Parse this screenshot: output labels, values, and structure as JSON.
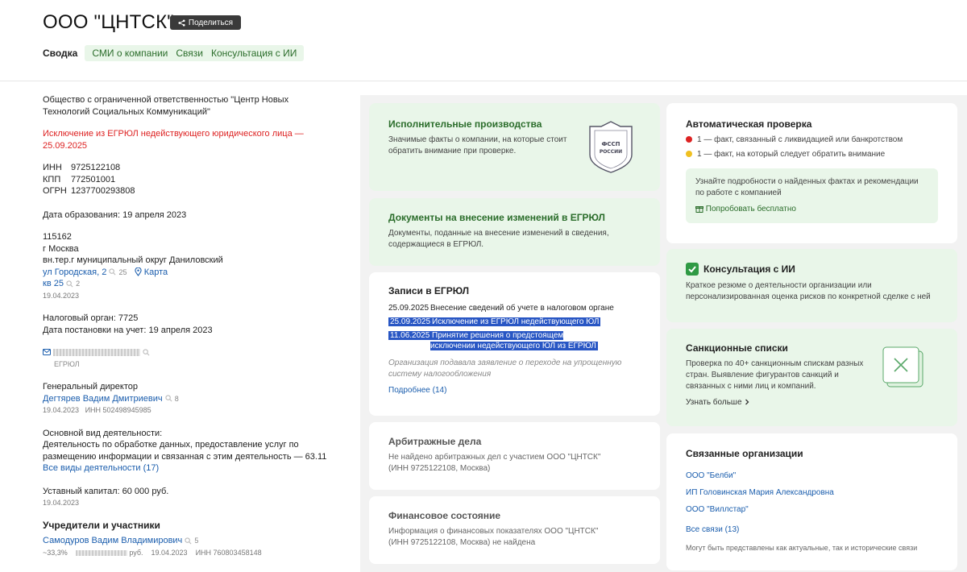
{
  "header": {
    "title": "ООО \"ЦНТСК\"",
    "share_label": "Поделиться",
    "tab_active": "Сводка",
    "tabs": [
      "СМИ о компании",
      "Связи",
      "Консультация с ИИ"
    ]
  },
  "left": {
    "full_name": "Общество с ограниченной ответственностью \"Центр Новых Технологий Социальных Коммуникаций\"",
    "exclusion": "Исключение из ЕГРЮЛ недействующего юридического лица — 25.09.2025",
    "inn_label": "ИНН",
    "inn": "9725122108",
    "kpp_label": "КПП",
    "kpp": "772501001",
    "ogrn_label": "ОГРН",
    "ogrn": "1237700293808",
    "founded": "Дата образования: 19 апреля 2023",
    "addr_zip": "115162",
    "addr_city": "г Москва",
    "addr_district": "вн.тер.г муниципальный округ Даниловский",
    "addr_street": "ул Городская, 2",
    "addr_street_count": "25",
    "map_label": "Карта",
    "addr_flat": "кв 25",
    "addr_flat_count": "2",
    "addr_date": "19.04.2023",
    "tax_org": "Налоговый орган: 7725",
    "tax_date": "Дата постановки на учет: 19 апреля 2023",
    "email_source": "ЕГРЮЛ",
    "director_role": "Генеральный директор",
    "director_name": "Дегтярев Вадим Дмитриевич",
    "director_count": "8",
    "director_date": "19.04.2023",
    "director_inn": "ИНН 502498945985",
    "activity_label": "Основной вид деятельности:",
    "activity_text": "Деятельность по обработке данных, предоставление услуг по размещению информации и связанная с этим деятельность — 63.11",
    "activity_all": "Все виды деятельности (17)",
    "capital": "Уставный капитал: 60 000 руб.",
    "capital_date": "19.04.2023",
    "founders_title": "Учредители и участники",
    "founder_name": "Самодуров Вадим Владимирович",
    "founder_count": "5",
    "founder_share": "~33,3%",
    "founder_rub": "руб.",
    "founder_date": "19.04.2023",
    "founder_inn": "ИНН 760803458148"
  },
  "cards": {
    "fssp_title": "Исполнительные производства",
    "fssp_text": "Значимые факты о компании, на которые стоит обратить внимание при проверке.",
    "fssp_badge_1": "ФССП",
    "fssp_badge_2": "РОССИИ",
    "docs_title": "Документы на внесение изменений в ЕГРЮЛ",
    "docs_text": "Документы, поданные на внесение изменений в сведения, содержащиеся в ЕГРЮЛ.",
    "egrul_title": "Записи в ЕГРЮЛ",
    "egrul_rows": [
      {
        "date": "25.09.2025",
        "text": "Внесение сведений об учете в налоговом органе"
      },
      {
        "date": "25.09.2025",
        "text": "Исключение из ЕГРЮЛ недействующего ЮЛ"
      },
      {
        "date": "11.06.2025",
        "text": "Принятие решения о предстоящем исключении недействующего ЮЛ из ЕГРЮЛ"
      }
    ],
    "egrul_note": "Организация подавала заявление о переходе на упрощенную систему налогообложения",
    "egrul_more": "Подробнее (14)",
    "arb_title": "Арбитражные дела",
    "arb_text": "Не найдено арбитражных дел с участием ООО \"ЦНТСК\" (ИНН 9725122108, Москва)",
    "fin_title": "Финансовое состояние",
    "fin_text": "Информация о финансовых показателях ООО \"ЦНТСК\" (ИНН 9725122108, Москва) не найдена",
    "auto_title": "Автоматическая проверка",
    "auto_red": "1 — факт, связанный с ликвидацией или банкротством",
    "auto_yellow": "1 — факт, на который следует обратить внимание",
    "auto_promo": "Узнайте подробности о найденных фактах и рекомендации по работе с компанией",
    "auto_try": "Попробовать бесплатно",
    "ai_title": "Консультация с ИИ",
    "ai_text": "Краткое резюме о деятельности организации или персонализированная оценка рисков по конкретной сделке с ней",
    "sanc_title": "Санкционные списки",
    "sanc_text": "Проверка по 40+ санкционным спискам разных стран. Выявление фигурантов санкций и связанных с ними лиц и компаний.",
    "sanc_more": "Узнать больше",
    "rel_title": "Связанные организации",
    "rel_items": [
      "ООО \"Белби\"",
      "ИП Головинская Мария Александровна",
      "ООО \"Виллстар\""
    ],
    "rel_all": "Все связи (13)",
    "rel_note": "Могут быть представлены как актуальные, так и исторические связи"
  },
  "colors": {
    "accent_green": "#2b6d2b",
    "card_green": "#e9f6e9",
    "red": "#dd2222",
    "selection": "#2856c4"
  }
}
